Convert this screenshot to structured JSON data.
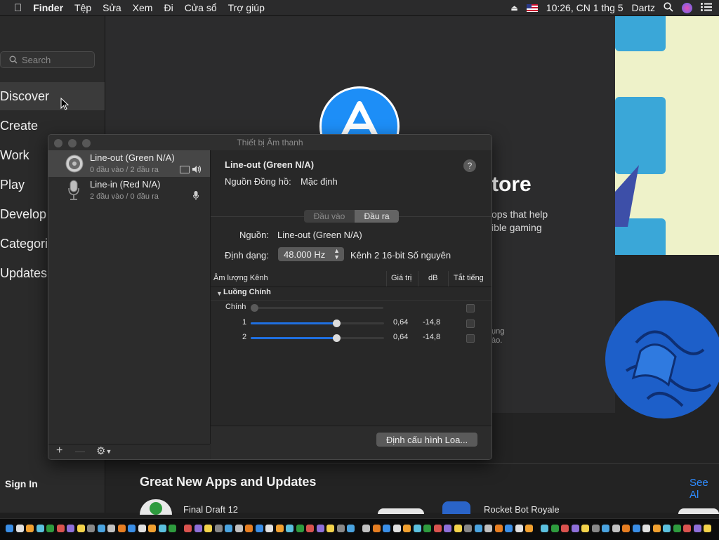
{
  "menubar": {
    "items": [
      "Finder",
      "Tệp",
      "Sửa",
      "Xem",
      "Đi",
      "Cửa sổ",
      "Trợ giúp"
    ],
    "clock": "10:26, CN 1 thg 5",
    "user": "Dartz"
  },
  "appstore": {
    "search_placeholder": "Search",
    "nav": [
      "Discover",
      "Create",
      "Work",
      "Play",
      "Develop",
      "Categories",
      "Updates"
    ],
    "sign_in": "Sign In",
    "hero_title": "tore",
    "hero_desc": "ops that help\nible gaming",
    "hero_small": "ụng\nào.",
    "section_title": "Great New Apps and Updates",
    "see_all": "See Al",
    "apps": [
      "Final Draft 12",
      "Rocket Bot Royale"
    ]
  },
  "audio": {
    "window_title": "Thiết bị Âm thanh",
    "devices": [
      {
        "name": "Line-out (Green N/A)",
        "sub": "0 đầu vào / 2 đầu ra"
      },
      {
        "name": "Line-in (Red N/A)",
        "sub": "2 đầu vào / 0 đầu ra"
      }
    ],
    "detail_title": "Line-out (Green N/A)",
    "clock_label": "Nguồn Đồng hồ:",
    "clock_value": "Mặc định",
    "tab_input": "Đầu vào",
    "tab_output": "Đầu ra",
    "source_label": "Nguồn:",
    "source_value": "Line-out (Green N/A)",
    "format_label": "Định dạng:",
    "format_value": "48.000 Hz",
    "format_desc": "Kênh 2 16-bit Số nguyên",
    "col_volume": "Âm lượng Kênh",
    "col_value": "Giá trị",
    "col_db": "dB",
    "col_mute": "Tắt tiếng",
    "stream": "Luồng Chính",
    "master": "Chính",
    "channels": [
      {
        "label": "1",
        "value": "0,64",
        "db": "-14,8",
        "level": 0.64
      },
      {
        "label": "2",
        "value": "0,64",
        "db": "-14,8",
        "level": 0.64
      }
    ],
    "help": "?",
    "configure_button": "Định cấu hình Loa...",
    "footer_add": "+",
    "footer_remove": "—"
  },
  "colors": {
    "accent": "#1f6fe0",
    "appstore_blue": "#1d8ef7",
    "link": "#2f8cff"
  }
}
